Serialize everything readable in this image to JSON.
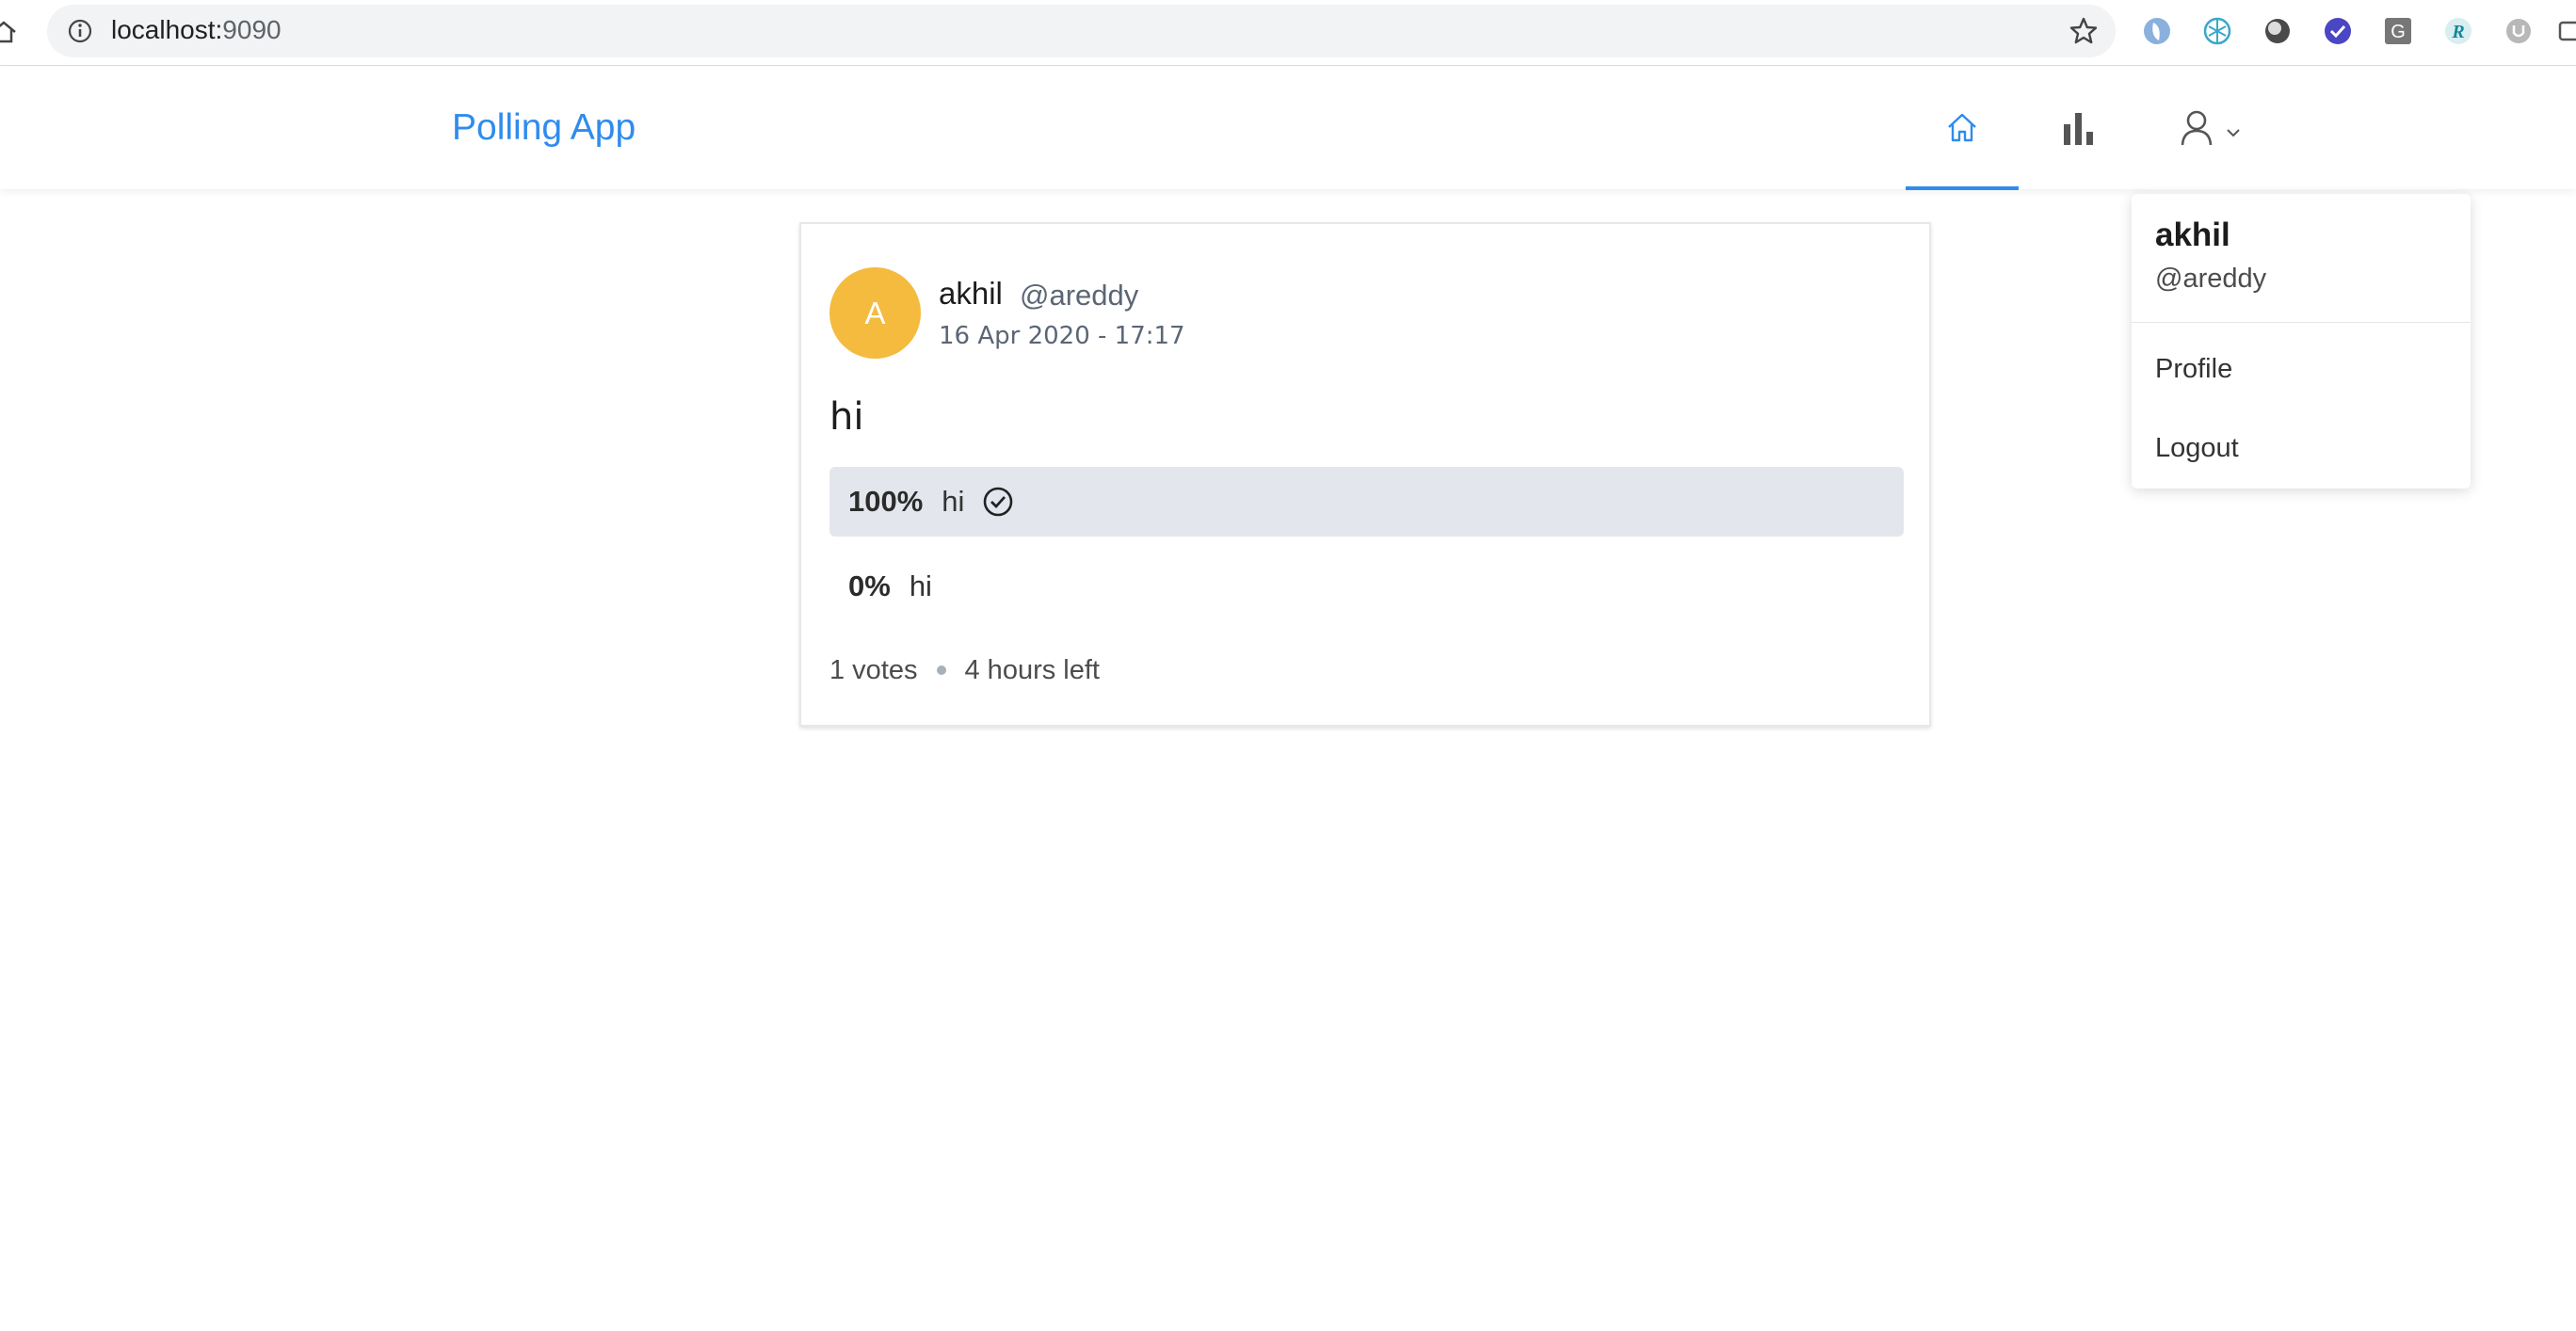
{
  "browser": {
    "url_host": "localhost:",
    "url_port": "9090"
  },
  "header": {
    "brand": "Polling App",
    "accent_color": "#2f8ced"
  },
  "poll": {
    "avatar_letter": "A",
    "avatar_color": "#f4bb3f",
    "creator_name": "akhil",
    "creator_username": "@areddy",
    "created": "16 Apr 2020 - 17:17",
    "question": "hi",
    "choices": [
      {
        "percent": "100%",
        "text": "hi",
        "selected": true
      },
      {
        "percent": "0%",
        "text": "hi",
        "selected": false
      }
    ],
    "votes": "1 votes",
    "time_left": "4 hours left"
  },
  "dropdown": {
    "name": "akhil",
    "username": "@areddy",
    "items": [
      "Profile",
      "Logout"
    ]
  }
}
